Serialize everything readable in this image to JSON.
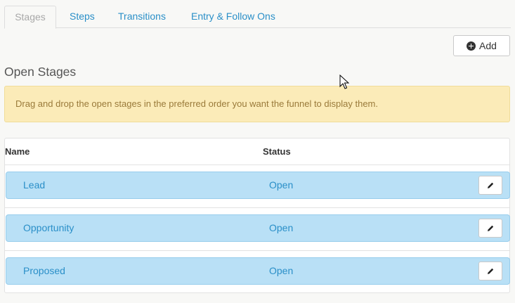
{
  "tabs": [
    {
      "label": "Stages",
      "active": true
    },
    {
      "label": "Steps",
      "active": false
    },
    {
      "label": "Transitions",
      "active": false
    },
    {
      "label": "Entry & Follow Ons",
      "active": false
    }
  ],
  "toolbar": {
    "add_label": "Add",
    "add_icon": "plus-circle-icon"
  },
  "section": {
    "title": "Open Stages"
  },
  "alert": {
    "text": "Drag and drop the open stages in the preferred order you want the funnel to display them."
  },
  "table": {
    "columns": {
      "name": "Name",
      "status": "Status"
    },
    "rows": [
      {
        "name": "Lead",
        "status": "Open"
      },
      {
        "name": "Opportunity",
        "status": "Open"
      },
      {
        "name": "Proposed",
        "status": "Open"
      }
    ],
    "row_action_icon": "pencil-icon"
  },
  "colors": {
    "link": "#2a8fc8",
    "row_bg": "#b9e0f6",
    "alert_bg": "#fbebb8",
    "alert_text": "#9a7a3a"
  }
}
